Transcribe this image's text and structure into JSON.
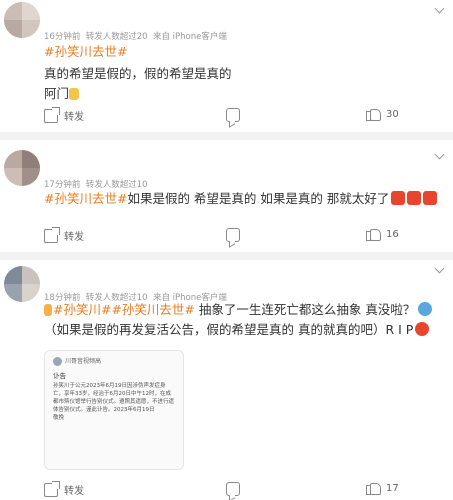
{
  "posts": [
    {
      "time": "16分钟前",
      "forwards": "转发人数超过20",
      "source": "来自 iPhone客户端",
      "topic": "#孙笑川去世#",
      "lines": [
        "真的希望是假的，假的希望是真的",
        "阿门"
      ],
      "emoji_after_line2": "praying-emoji",
      "share_label": "转发",
      "like_count": "30"
    },
    {
      "time": "17分钟前",
      "forwards": "转发人数超过10",
      "topic": "#孙笑川去世#",
      "text": "如果是假的 希望是真的 如果是真的 那就太好了",
      "emojis": [
        "red-emoji",
        "red-emoji",
        "red-emoji"
      ],
      "share_label": "转发",
      "like_count": "16"
    },
    {
      "time": "18分钟前",
      "forwards": "转发人数超过10",
      "source": "来自 iPhone客户端",
      "topics": [
        "#孙笑川#",
        "#孙笑川去世#"
      ],
      "text_a": " 抽象了一生连死亡都这么抽象 真没啦？",
      "text_b": "（如果是假的再发复活公告，假的希望是真的 真的就真的吧）R I P",
      "notice": {
        "header": "川哥音视频高",
        "title": "讣告",
        "body": "孙笑川于公元2023年6月19日因涉伪声发症身亡，享年33岁，经治于6月20日中午12时，在成都市殡仪馆举行告别仪式。遵照其遗愿，不进行遗体告别仪式。谨此讣告。2023年6月19日",
        "sign": "敬挽"
      },
      "share_label": "转发",
      "like_count": "17"
    }
  ]
}
